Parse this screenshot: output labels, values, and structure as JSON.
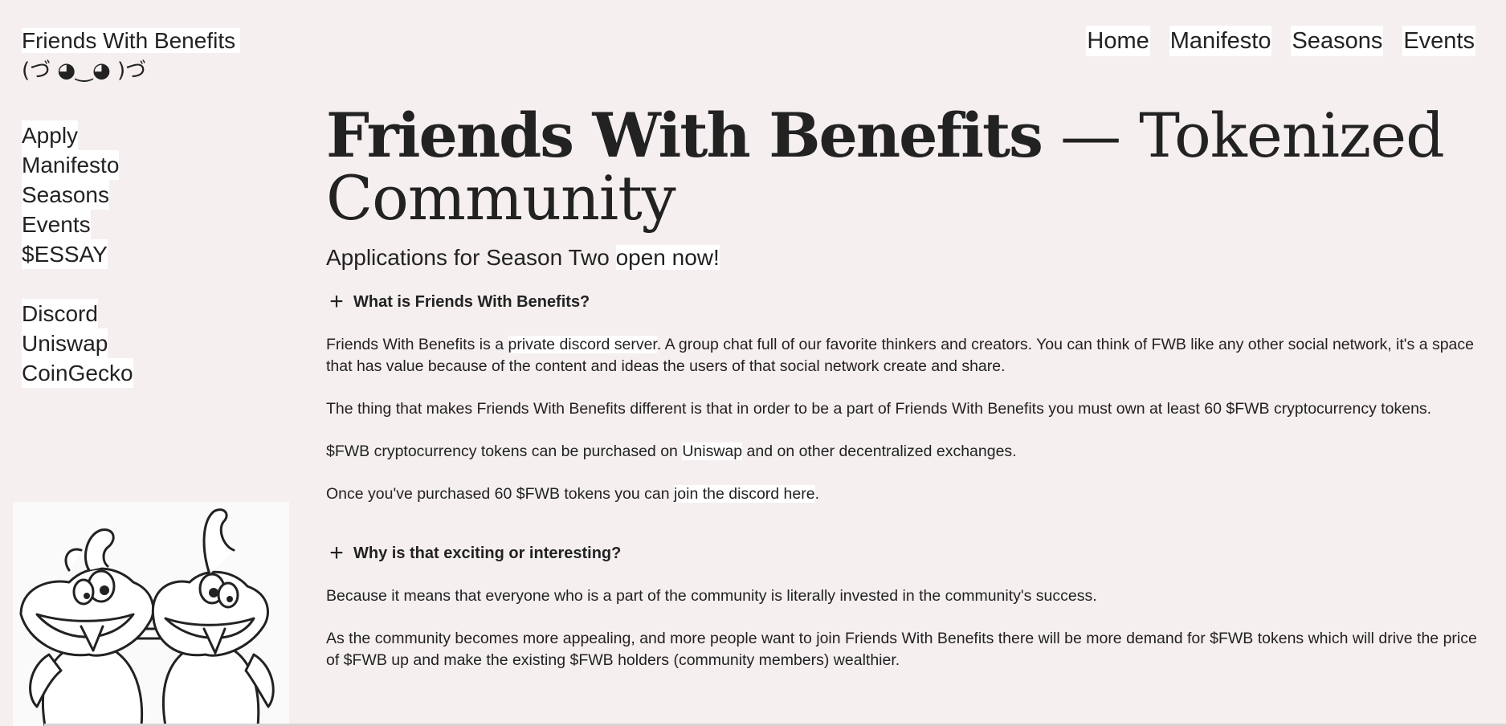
{
  "site": {
    "title": "Friends With Benefits",
    "kaomoji": "(づ ◕‿◕ )づ"
  },
  "topnav": [
    "Home",
    "Manifesto",
    "Seasons",
    "Events"
  ],
  "sidebar": {
    "primary": [
      "Apply",
      "Manifesto",
      "Seasons",
      "Events",
      "$ESSAY"
    ],
    "secondary": [
      "Discord",
      "Uniswap",
      "CoinGecko"
    ]
  },
  "hero": {
    "title_bold": "Friends With Benefits",
    "title_rest": " — Tokenized Community",
    "announcement_prefix": "Applications for Season Two ",
    "announcement_link": "open now!"
  },
  "faq": [
    {
      "question": "What is Friends With Benefits?",
      "p1_a": "Friends With Benefits is a ",
      "p1_link": "private discord server",
      "p1_b": ". A group chat full of our favorite thinkers and creators. You can think of FWB like any other social network, it's a space that has value because of the content and ideas the users of that social network create and share.",
      "p2": "The thing that makes Friends With Benefits different is that in order to be a part of Friends With Benefits you must own at least 60 $FWB cryptocurrency tokens.",
      "p3_a": "$FWB cryptocurrency tokens can be purchased on ",
      "p3_link": "Uniswap",
      "p3_b": " and on other decentralized exchanges.",
      "p4_a": "Once you've purchased 60 $FWB tokens you can ",
      "p4_link": "join the discord here",
      "p4_b": "."
    },
    {
      "question": "Why is that exciting or interesting?",
      "p1": "Because it means that everyone who is a part of the community is literally invested in the community's success.",
      "p2": "As the community becomes more appealing, and more people want to join Friends With Benefits there will be more demand for $FWB tokens which will drive the price of $FWB up and make the existing $FWB holders (community members) wealthier."
    }
  ],
  "icons": {
    "expand": "plus-icon"
  }
}
